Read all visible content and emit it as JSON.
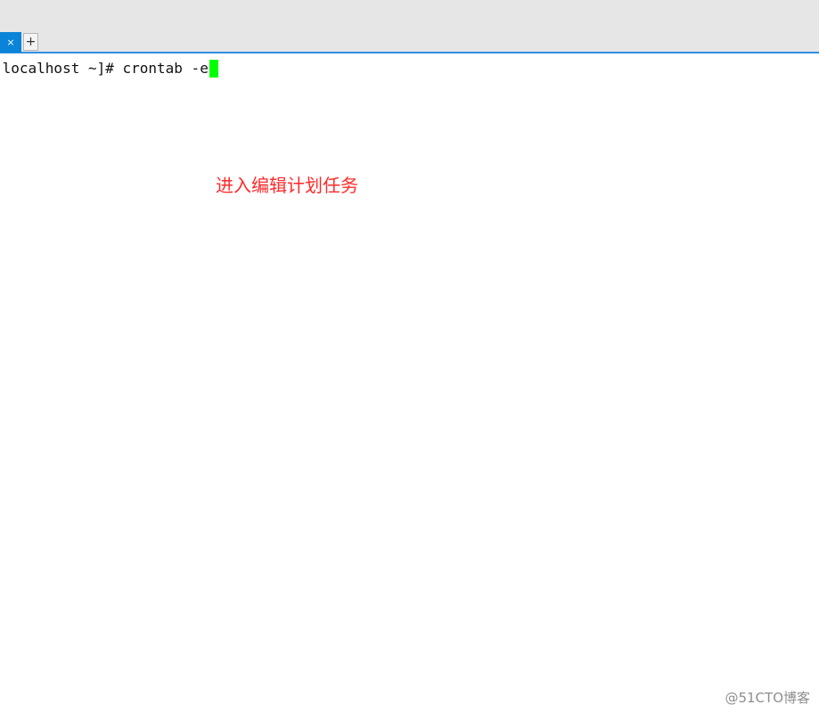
{
  "tabs": {
    "active_tab_close_glyph": "×",
    "add_tab_glyph": "+"
  },
  "terminal": {
    "prompt_and_command": "]localhost ~]# crontab -e"
  },
  "annotation": {
    "text": "进入编辑计划任务"
  },
  "watermark": {
    "text": "@51CTO博客"
  },
  "colors": {
    "accent_blue": "#0a84d8",
    "cursor_green": "#00ff00",
    "annotation_red": "#ff2a2a"
  }
}
